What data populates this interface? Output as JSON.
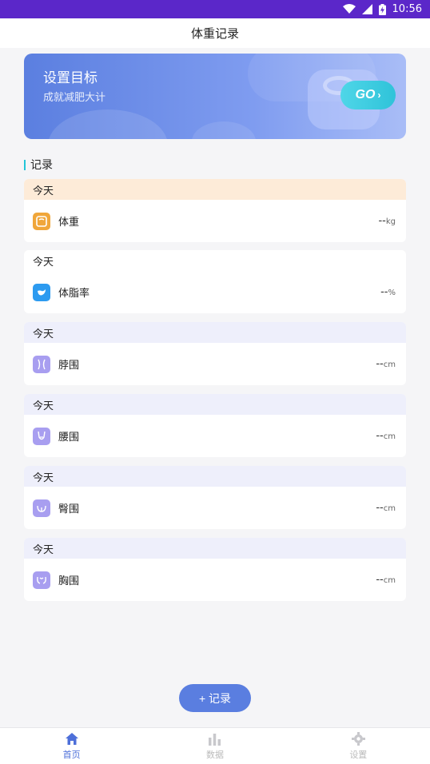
{
  "status_bar": {
    "time": "10:56",
    "wifi_icon": "wifi-icon",
    "signal_icon": "signal-icon",
    "battery_icon": "battery-charging-icon"
  },
  "header": {
    "title": "体重记录"
  },
  "banner": {
    "title": "设置目标",
    "subtitle": "成就减肥大计",
    "go_label": "GO",
    "go_icon": "chevron-right-icon"
  },
  "records": {
    "section_title": "记录",
    "items": [
      {
        "day": "今天",
        "name": "体重",
        "value": "--",
        "unit": "kg",
        "icon": "scale-icon",
        "header_bg": "#fdebd8",
        "icon_color": "#f0a63a"
      },
      {
        "day": "今天",
        "name": "体脂率",
        "value": "--",
        "unit": "%",
        "icon": "body-fat-icon",
        "header_bg": "#ffffff",
        "icon_color": "#2d9bf0"
      },
      {
        "day": "今天",
        "name": "脖围",
        "value": "--",
        "unit": "cm",
        "icon": "neck-icon",
        "header_bg": "#eeeffb",
        "icon_color": "#a89ef0"
      },
      {
        "day": "今天",
        "name": "腰围",
        "value": "--",
        "unit": "cm",
        "icon": "waist-icon",
        "header_bg": "#eeeffb",
        "icon_color": "#a89ef0"
      },
      {
        "day": "今天",
        "name": "臀围",
        "value": "--",
        "unit": "cm",
        "icon": "hip-icon",
        "header_bg": "#eeeffb",
        "icon_color": "#a89ef0"
      },
      {
        "day": "今天",
        "name": "胸围",
        "value": "--",
        "unit": "cm",
        "icon": "chest-icon",
        "header_bg": "#eeeffb",
        "icon_color": "#a89ef0"
      }
    ]
  },
  "fab": {
    "label": "+ 记录"
  },
  "tabbar": {
    "tabs": [
      {
        "label": "首页",
        "icon": "home-icon",
        "active": true
      },
      {
        "label": "数据",
        "icon": "bar-chart-icon",
        "active": false
      },
      {
        "label": "设置",
        "icon": "gear-icon",
        "active": false
      }
    ]
  },
  "colors": {
    "accent": "#5a7ee0",
    "status_bar": "#5b27c9",
    "go_button": "#2fc3d9",
    "section_marker": "#23c6d8"
  }
}
